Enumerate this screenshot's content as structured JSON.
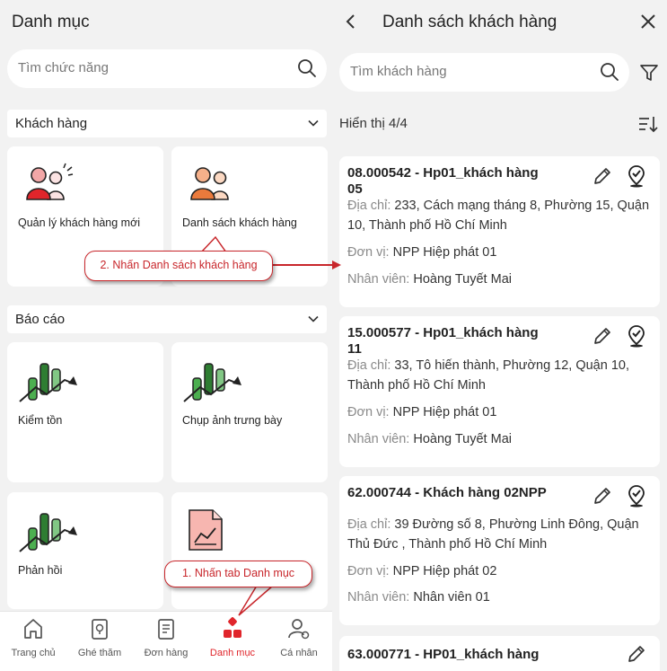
{
  "left": {
    "title": "Danh mục",
    "search_placeholder": "Tìm chức năng",
    "sections": [
      {
        "title": "Khách hàng",
        "tiles": [
          {
            "label": "Quản lý khách hàng mới",
            "icon": "users-alert-icon"
          },
          {
            "label": "Danh sách khách hàng",
            "icon": "users-icon"
          }
        ]
      },
      {
        "title": "Báo cáo",
        "tiles": [
          {
            "label": "Kiểm tồn",
            "icon": "chart-icon"
          },
          {
            "label": "Chụp ảnh trưng bày",
            "icon": "chart-icon"
          },
          {
            "label": "Phản hồi",
            "icon": "chart-icon"
          },
          {
            "label": "",
            "icon": "report-document-icon"
          }
        ]
      }
    ],
    "bottom_nav": [
      {
        "label": "Trang chủ",
        "icon": "home-icon"
      },
      {
        "label": "Ghé thăm",
        "icon": "visit-icon"
      },
      {
        "label": "Đơn hàng",
        "icon": "order-icon"
      },
      {
        "label": "Danh mục",
        "icon": "grid-icon",
        "active": true
      },
      {
        "label": "Cá nhân",
        "icon": "profile-icon"
      }
    ]
  },
  "right": {
    "title": "Danh sách khách hàng",
    "search_placeholder": "Tìm khách hàng",
    "count_text": "Hiển thị 4/4",
    "address_key": "Địa chỉ: ",
    "unit_key": "Đơn vị: ",
    "staff_key": "Nhân viên: ",
    "customers": [
      {
        "name": "08.000542 - Hp01_khách hàng 05",
        "address": "233, Cách mạng tháng 8, Phường 15, Quận 10, Thành phố Hồ Chí Minh",
        "unit": "NPP Hiệp phát 01",
        "staff": "Hoàng Tuyết Mai"
      },
      {
        "name": "15.000577 - Hp01_khách hàng 11",
        "address": "33, Tô hiến thành, Phường 12, Quận 10, Thành phố Hồ Chí Minh",
        "unit": "NPP Hiệp phát 01",
        "staff": "Hoàng Tuyết Mai"
      },
      {
        "name": "62.000744 - Khách hàng 02NPP",
        "address": "39 Đường số 8, Phường Linh Đông, Quận Thủ Đức , Thành phố Hồ Chí Minh",
        "unit": "NPP Hiệp phát 02",
        "staff": "Nhân viên 01"
      },
      {
        "name": "63.000771 - HP01_khách hàng"
      }
    ]
  },
  "callouts": {
    "step1": "1. Nhấn tab Danh mục",
    "step2": "2. Nhấn Danh sách khách hàng"
  },
  "colors": {
    "accent": "#e0252b",
    "callout": "#c8262b",
    "background": "#f2f2f2"
  }
}
